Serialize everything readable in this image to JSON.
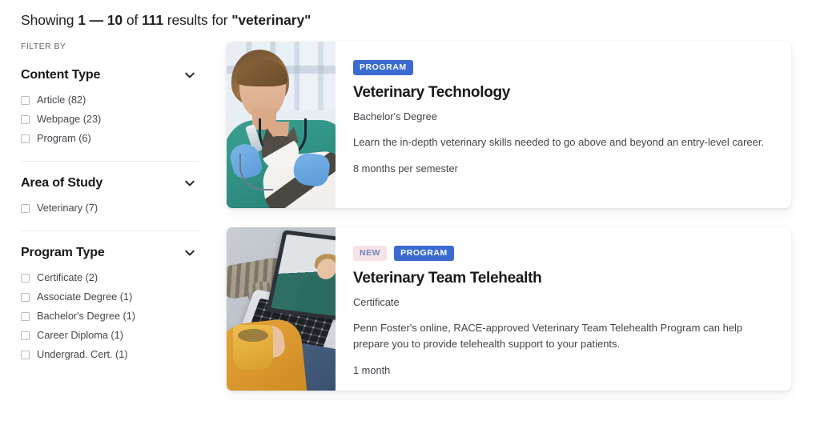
{
  "header": {
    "prefix": "Showing",
    "range_start": "1",
    "dash": "—",
    "range_end": "10",
    "of": "of",
    "total": "111",
    "results_for": "results for",
    "query": "\"veterinary\""
  },
  "sidebar": {
    "filter_by_label": "FILTER BY",
    "groups": [
      {
        "title": "Content Type",
        "toggle_icon": "chevron-down-icon",
        "options": [
          {
            "label": "Article (82)",
            "checked": false
          },
          {
            "label": "Webpage (23)",
            "checked": false
          },
          {
            "label": "Program (6)",
            "checked": false
          }
        ]
      },
      {
        "title": "Area of Study",
        "toggle_icon": "chevron-down-icon",
        "options": [
          {
            "label": "Veterinary (7)",
            "checked": false
          }
        ]
      },
      {
        "title": "Program Type",
        "toggle_icon": "chevron-down-icon",
        "options": [
          {
            "label": "Certificate (2)",
            "checked": false
          },
          {
            "label": "Associate Degree (1)",
            "checked": false
          },
          {
            "label": "Bachelor's Degree (1)",
            "checked": false
          },
          {
            "label": "Career Diploma (1)",
            "checked": false
          },
          {
            "label": "Undergrad. Cert. (1)",
            "checked": false
          }
        ]
      }
    ]
  },
  "results": [
    {
      "badges": [
        {
          "label": "PROGRAM",
          "style": "program"
        }
      ],
      "title": "Veterinary Technology",
      "subtitle": "Bachelor's Degree",
      "description": "Learn the in-depth veterinary skills needed to go above and beyond an entry-level career.",
      "meta": "8 months per semester",
      "image_alt": "veterinarian-examining-cat-photo"
    },
    {
      "badges": [
        {
          "label": "NEW",
          "style": "new"
        },
        {
          "label": "PROGRAM",
          "style": "program"
        }
      ],
      "title": "Veterinary Team Telehealth",
      "subtitle": "Certificate",
      "description": "Penn Foster's online, RACE-approved Veterinary Team Telehealth Program can help prepare you to provide telehealth support to your patients.",
      "meta": "1 month",
      "image_alt": "telehealth-video-call-with-cat-photo"
    }
  ],
  "colors": {
    "badge_program_bg": "#3b6bd1",
    "badge_program_text": "#ffffff",
    "badge_new_bg": "#f7e3e5",
    "badge_new_text": "#6f83c4",
    "page_bg": "#ffffff",
    "text_primary": "#17181a",
    "text_secondary": "#42454a",
    "divider": "#e9eaec"
  }
}
